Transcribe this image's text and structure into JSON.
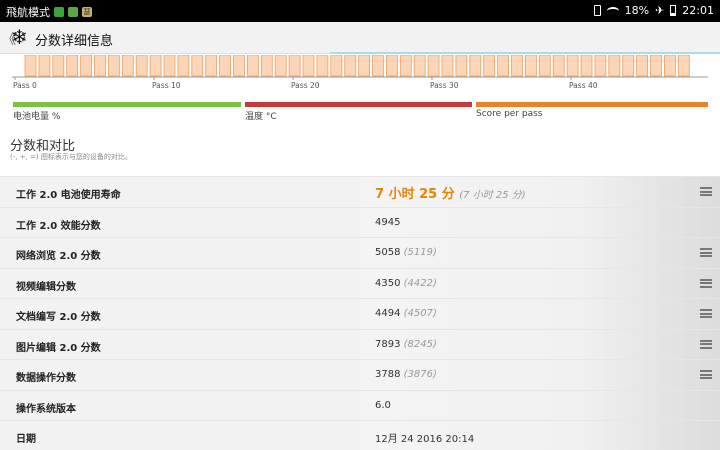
{
  "status_bar": {
    "mode_text": "飛航模式",
    "app_icon_text": "瑟",
    "battery_percent": "18%",
    "time": "22:01",
    "icons": [
      "message-icon",
      "chat-icon",
      "app-icon",
      "vibrate-icon",
      "wifi-icon",
      "airplane-icon",
      "battery-icon"
    ]
  },
  "app_bar": {
    "back_glyph": "《",
    "logo_glyph": "❄",
    "title": "分数详细信息"
  },
  "chart": {
    "pass_count": 48,
    "bar_fill": "#fbd5b5",
    "bar_stroke": "#f0a060",
    "axis_labels": [
      {
        "text": "Pass 0",
        "pass": 0
      },
      {
        "text": "Pass 10",
        "pass": 10
      },
      {
        "text": "Pass 20",
        "pass": 20
      },
      {
        "text": "Pass 30",
        "pass": 30
      },
      {
        "text": "Pass 40",
        "pass": 40
      }
    ],
    "legend": [
      {
        "label": "电池电量 %",
        "color": "#7cc142"
      },
      {
        "label": "温度 °C",
        "color": "#c8383a"
      },
      {
        "label": "Score per pass",
        "color": "#e8832a"
      }
    ]
  },
  "section": {
    "title": "分数和对比",
    "subtitle": "(-, +, =) 图标表示与您的设备的对比。"
  },
  "table": {
    "rows": [
      {
        "label": "工作 2.0 电池使用寿命",
        "value": "7 小时 25 分",
        "ref": "(7 小时 25 分)",
        "highlight": true,
        "expandable": true
      },
      {
        "label": "工作 2.0 效能分数",
        "value": "4945",
        "ref": "",
        "highlight": false,
        "expandable": false
      },
      {
        "label": "网络浏览 2.0 分数",
        "value": "5058",
        "ref": "(5119)",
        "highlight": false,
        "expandable": true
      },
      {
        "label": "视频编辑分数",
        "value": "4350",
        "ref": "(4422)",
        "highlight": false,
        "expandable": true
      },
      {
        "label": "文档编写 2.0 分数",
        "value": "4494",
        "ref": "(4507)",
        "highlight": false,
        "expandable": true
      },
      {
        "label": "图片编辑 2.0 分数",
        "value": "7893",
        "ref": "(8245)",
        "highlight": false,
        "expandable": true
      },
      {
        "label": "数据操作分数",
        "value": "3788",
        "ref": "(3876)",
        "highlight": false,
        "expandable": true
      },
      {
        "label": "操作系统版本",
        "value": "6.0",
        "ref": "",
        "highlight": false,
        "expandable": false
      },
      {
        "label": "日期",
        "value": "12月 24 2016 20:14",
        "ref": "",
        "highlight": false,
        "expandable": false
      }
    ]
  }
}
